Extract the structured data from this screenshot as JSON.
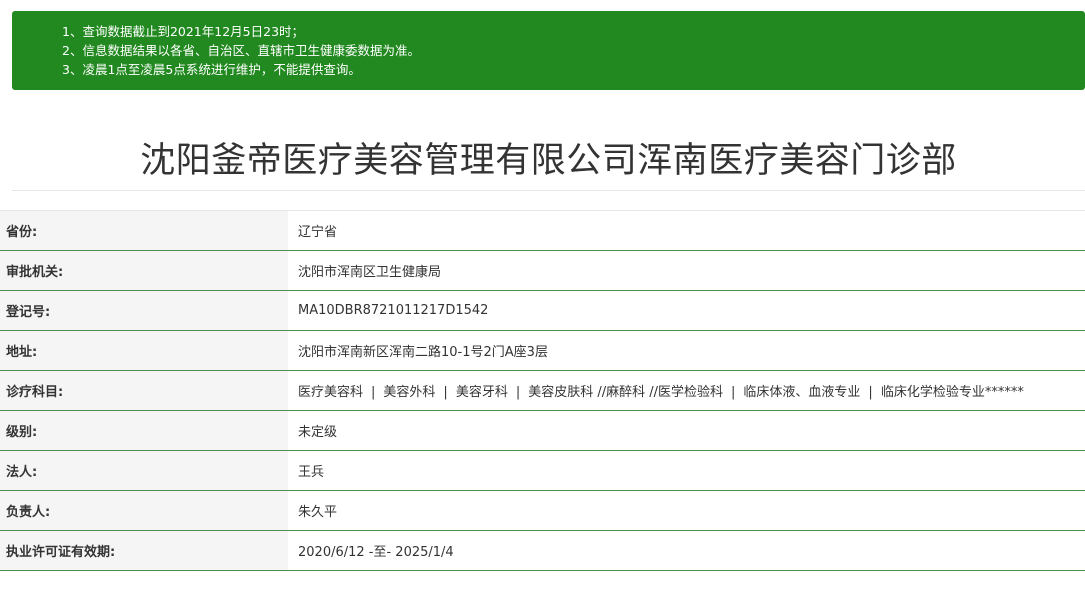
{
  "notice": {
    "lines": [
      "1、查询数据截止到2021年12月5日23时；",
      "2、信息数据结果以各省、自治区、直辖市卫生健康委数据为准。",
      "3、凌晨1点至凌晨5点系统进行维护，不能提供查询。"
    ]
  },
  "title": "沈阳釜帝医疗美容管理有限公司浑南医疗美容门诊部",
  "rows": {
    "province": {
      "label": "省份:",
      "value": "辽宁省"
    },
    "authority": {
      "label": "审批机关:",
      "value": "沈阳市浑南区卫生健康局"
    },
    "reg_no": {
      "label": "登记号:",
      "value": "MA10DBR8721011217D1542"
    },
    "address": {
      "label": "地址:",
      "value": "沈阳市浑南新区浑南二路10-1号2门A座3层"
    },
    "subjects": {
      "label": "诊疗科目:",
      "items": [
        "医疗美容科",
        "美容外科",
        "美容牙科",
        "美容皮肤科 //麻醉科 //医学检验科",
        "临床体液、血液专业",
        "临床化学检验专业******"
      ],
      "separator": "|"
    },
    "level": {
      "label": "级别:",
      "value": "未定级"
    },
    "legal_person": {
      "label": "法人:",
      "value": "王兵"
    },
    "person_in_charge": {
      "label": "负责人:",
      "value": "朱久平"
    },
    "validity": {
      "label": "执业许可证有效期:",
      "value": "2020/6/12 -至- 2025/1/4"
    }
  }
}
